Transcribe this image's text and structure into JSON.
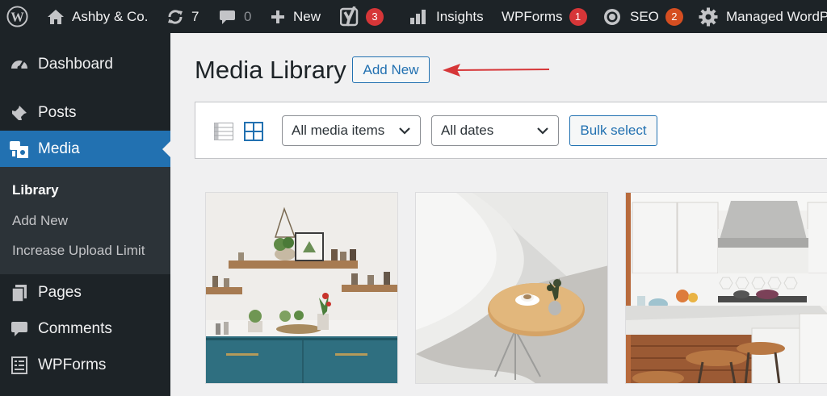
{
  "admin_bar": {
    "site_name": "Ashby & Co.",
    "updates_count": "7",
    "comments_count": "0",
    "new_label": "New",
    "yoast_badge": "3",
    "insights_label": "Insights",
    "wpforms_label": "WPForms",
    "wpforms_badge": "1",
    "seo_label": "SEO",
    "seo_badge": "2",
    "managed_label": "Managed WordP"
  },
  "sidebar": {
    "dashboard": "Dashboard",
    "posts": "Posts",
    "media": "Media",
    "media_submenu": [
      "Library",
      "Add New",
      "Increase Upload Limit"
    ],
    "pages": "Pages",
    "comments": "Comments",
    "wpforms": "WPForms"
  },
  "main": {
    "title": "Media Library",
    "add_new_label": "Add New",
    "filters": {
      "type_selected": "All media items",
      "date_selected": "All dates",
      "bulk_select_label": "Bulk select"
    },
    "view_mode": "grid",
    "media_items": [
      {
        "description": "kitchen shelves with plants photo"
      },
      {
        "description": "white chair and round wooden table photo"
      },
      {
        "description": "white kitchen with island and stools photo"
      }
    ]
  },
  "colors": {
    "admin_dark": "#1d2327",
    "accent_blue": "#2271b1",
    "badge_red": "#d63638",
    "annotation_arrow": "#d63638"
  }
}
